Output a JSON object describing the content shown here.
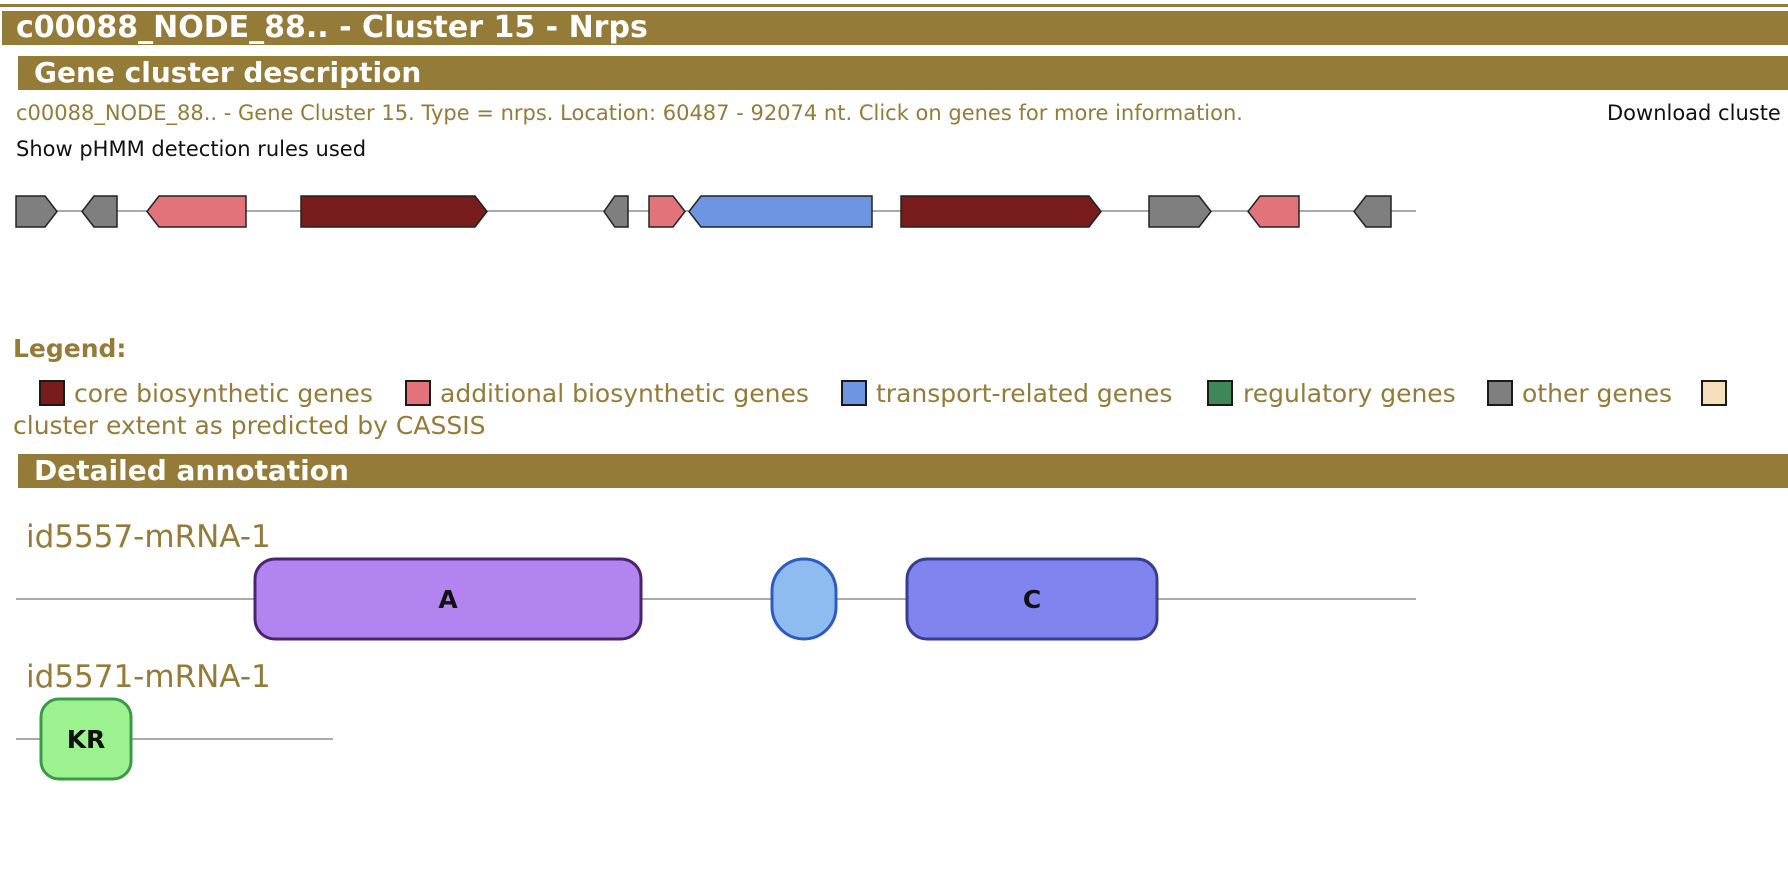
{
  "header": {
    "title": "c00088_NODE_88.. - Cluster 15 - Nrps"
  },
  "description_section": {
    "heading": "Gene cluster description",
    "text": "c00088_NODE_88.. - Gene Cluster 15. Type = nrps. Location: 60487 - 92074 nt. Click on genes for more information.",
    "download_label": "Download cluste",
    "rules_link": "Show pHMM detection rules used"
  },
  "colors": {
    "brand": "#947b38",
    "core": "#781c1e",
    "additional": "#e2737a",
    "transport": "#6e95e2",
    "regulatory": "#3f8659",
    "other": "#7f7f7f",
    "cassis": "#f3dfba"
  },
  "cluster_genes": [
    {
      "type": "other",
      "strand": "+"
    },
    {
      "type": "other",
      "strand": "-"
    },
    {
      "type": "additional",
      "strand": "-"
    },
    {
      "type": "core",
      "strand": "+"
    },
    {
      "type": "other",
      "strand": "-"
    },
    {
      "type": "additional",
      "strand": "+"
    },
    {
      "type": "transport",
      "strand": "-"
    },
    {
      "type": "core",
      "strand": "+"
    },
    {
      "type": "other",
      "strand": "+"
    },
    {
      "type": "additional",
      "strand": "-"
    },
    {
      "type": "other",
      "strand": "-"
    }
  ],
  "legend": {
    "title": "Legend:",
    "items": [
      {
        "label": "core biosynthetic genes",
        "color": "#781c1e"
      },
      {
        "label": "additional biosynthetic genes",
        "color": "#e2737a"
      },
      {
        "label": "transport-related genes",
        "color": "#6e95e2"
      },
      {
        "label": "regulatory genes",
        "color": "#3f8659"
      },
      {
        "label": "other genes",
        "color": "#7f7f7f"
      },
      {
        "label": "cluster extent as predicted by CASSIS",
        "color": "#f3dfba"
      }
    ]
  },
  "annotation_section": {
    "heading": "Detailed annotation",
    "genes": [
      {
        "id": "id5557-mRNA-1",
        "domains": [
          {
            "label": "A",
            "fill": "#b184ef",
            "stroke": "#4b2471"
          },
          {
            "label": "",
            "fill": "#8ebcf1",
            "stroke": "#2e5bc1"
          },
          {
            "label": "C",
            "fill": "#8184ef",
            "stroke": "#383d8f"
          }
        ]
      },
      {
        "id": "id5571-mRNA-1",
        "domains": [
          {
            "label": "KR",
            "fill": "#9df290",
            "stroke": "#3c9a47"
          }
        ]
      }
    ]
  }
}
